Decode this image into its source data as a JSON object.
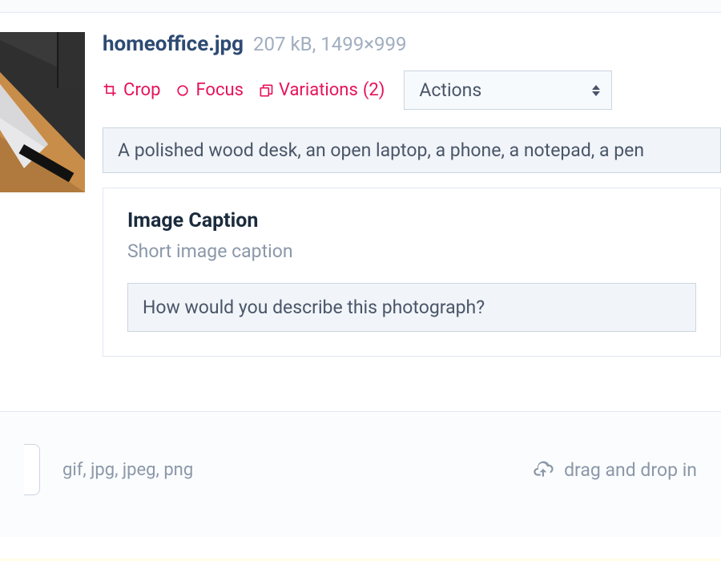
{
  "file": {
    "name": "homeoffice.jpg",
    "meta": "207 kB, 1499×999"
  },
  "tools": {
    "crop": "Crop",
    "focus": "Focus",
    "variations": "Variations",
    "variations_count": "(2)",
    "actions_select": "Actions"
  },
  "description": {
    "value": "A polished wood desk, an open laptop, a phone, a notepad, a pen"
  },
  "caption": {
    "title": "Image Caption",
    "subtitle": "Short image caption",
    "value": "How would you describe this photograph?"
  },
  "upload": {
    "formats": "gif, jpg, jpeg, png",
    "dragdrop": "drag and drop in"
  }
}
